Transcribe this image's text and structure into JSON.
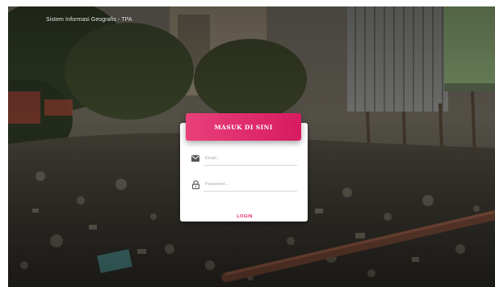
{
  "app": {
    "title": "Sistem Informasi Geografis - TPA"
  },
  "login": {
    "header": "MASUK DI SINI",
    "email_placeholder": "Email...",
    "password_placeholder": "Password...",
    "email_icon": "envelope-icon",
    "password_icon": "lock-icon",
    "button_label": "LOGIN"
  },
  "colors": {
    "accent": "#e91e63",
    "header_gradient_start": "#e8407a",
    "header_gradient_end": "#d81b60"
  }
}
